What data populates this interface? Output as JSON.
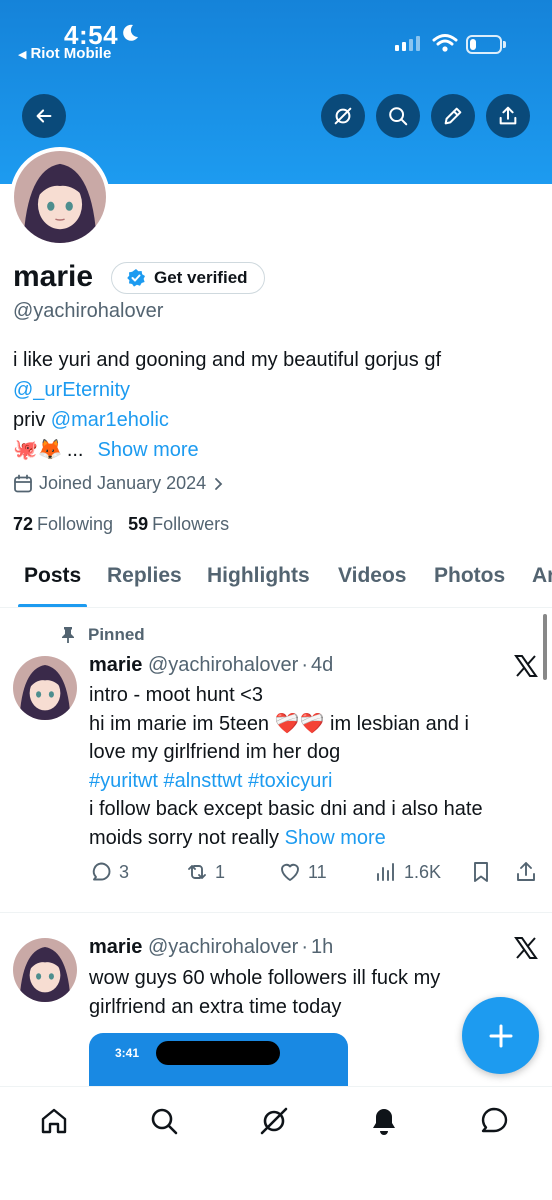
{
  "status_bar": {
    "time": "4:54",
    "carrier": "Riot Mobile",
    "battery_level": 0.2
  },
  "header": {
    "back_icon": "arrow-left-icon",
    "actions": [
      "grok-icon",
      "search-icon",
      "edit-icon",
      "share-icon"
    ]
  },
  "profile": {
    "name": "marie",
    "verify_label": "Get verified",
    "handle": "@yachirohalover",
    "bio_line1": "i like yuri and gooning and my beautiful gorjus gf",
    "bio_mention1": "@_urEternity",
    "bio_line3_prefix": "priv",
    "bio_mention2": "@mar1eholic",
    "bio_emoji": "🐙🦊",
    "bio_ellipsis": "...",
    "show_more": "Show more",
    "joined": "Joined January 2024",
    "following_count": "72",
    "following_label": "Following",
    "followers_count": "59",
    "followers_label": "Followers"
  },
  "tabs": [
    "Posts",
    "Replies",
    "Highlights",
    "Videos",
    "Photos",
    "Articles"
  ],
  "active_tab": "Posts",
  "posts": [
    {
      "pinned_label": "Pinned",
      "name": "marie",
      "handle": "@yachirohalover",
      "sep": "·",
      "time": "4d",
      "line1": "intro - moot hunt <3",
      "line2_a": "hi im marie im 5teen",
      "line2_emoji": "❤️‍🩹❤️‍🩹",
      "line2_b": "im lesbian and i",
      "line3": "love my girlfriend im her dog",
      "hashtags": "#yuritwt #alnsttwt #toxicyuri",
      "line5": "i follow back except basic dni and i also hate",
      "line6": "moids sorry not really",
      "show_more": "Show more",
      "replies": "3",
      "reposts": "1",
      "likes": "11",
      "views": "1.6K"
    },
    {
      "name": "marie",
      "handle": "@yachirohalover",
      "sep": "·",
      "time": "1h",
      "line1": "wow guys 60 whole followers ill fuck my",
      "line2": "girlfriend an extra time today",
      "media_time": "3:41"
    }
  ],
  "bottom_nav": [
    "home-icon",
    "search-icon",
    "grok-icon",
    "notifications-icon",
    "messages-icon"
  ],
  "colors": {
    "accent": "#1d9bf0",
    "banner": "#1d9bf0",
    "text": "#0f1419",
    "muted": "#536471"
  }
}
